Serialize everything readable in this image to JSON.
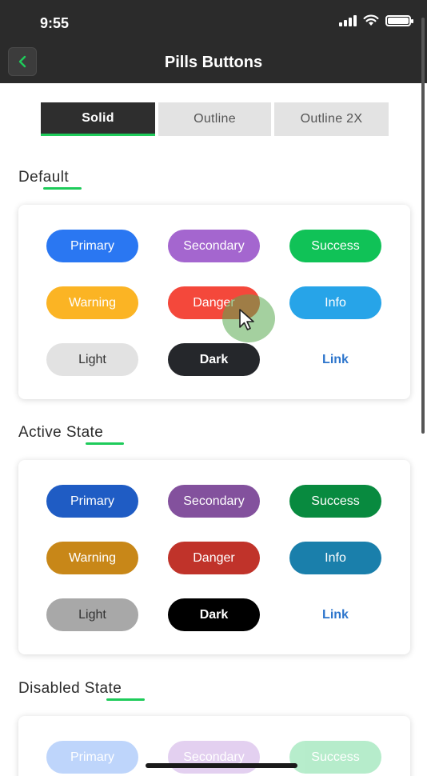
{
  "status_bar": {
    "time": "9:55"
  },
  "header": {
    "title": "Pills Buttons",
    "back_icon": "chevron-left-icon",
    "accent": "#1ecb5a"
  },
  "tabs": [
    {
      "label": "Solid",
      "active": true
    },
    {
      "label": "Outline",
      "active": false
    },
    {
      "label": "Outline 2X",
      "active": false
    }
  ],
  "sections": {
    "default": {
      "title": "Default",
      "buttons": [
        {
          "label": "Primary",
          "color": "#2a77f2"
        },
        {
          "label": "Secondary",
          "color": "#a466cf"
        },
        {
          "label": "Success",
          "color": "#10c257"
        },
        {
          "label": "Warning",
          "color": "#fbb424"
        },
        {
          "label": "Danger",
          "color": "#f4483b"
        },
        {
          "label": "Info",
          "color": "#27a4e8"
        },
        {
          "label": "Light",
          "color": "#e2e2e2"
        },
        {
          "label": "Dark",
          "color": "#25272b"
        },
        {
          "label": "Link",
          "color": "#2e76cc"
        }
      ]
    },
    "active": {
      "title": "Active State",
      "buttons": [
        {
          "label": "Primary",
          "color": "#1f5cc4"
        },
        {
          "label": "Secondary",
          "color": "#83519d"
        },
        {
          "label": "Success",
          "color": "#088a3f"
        },
        {
          "label": "Warning",
          "color": "#c88718"
        },
        {
          "label": "Danger",
          "color": "#c0332a"
        },
        {
          "label": "Info",
          "color": "#1a7fab"
        },
        {
          "label": "Light",
          "color": "#a8a8a8"
        },
        {
          "label": "Dark",
          "color": "#000000"
        },
        {
          "label": "Link",
          "color": "#2e76cc"
        }
      ]
    },
    "disabled": {
      "title": "Disabled State",
      "buttons": [
        {
          "label": "Primary",
          "color": "#2a77f2"
        },
        {
          "label": "Secondary",
          "color": "#a466cf"
        },
        {
          "label": "Success",
          "color": "#10c257"
        }
      ]
    }
  }
}
